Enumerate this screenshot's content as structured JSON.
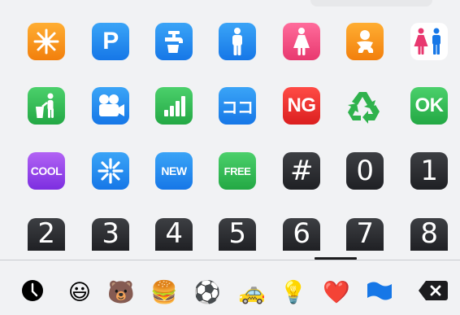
{
  "keyboard": {
    "rows": [
      [
        {
          "id": "eight-pointed-star",
          "icon": "eight-pointed-star-icon",
          "style": "orange"
        },
        {
          "id": "parking",
          "icon": "letter-p",
          "text": "P",
          "style": "blue"
        },
        {
          "id": "potable-water",
          "icon": "potable-water-icon",
          "style": "blue"
        },
        {
          "id": "mens-room",
          "icon": "man-icon",
          "style": "blue"
        },
        {
          "id": "womens-room",
          "icon": "woman-icon",
          "style": "pink"
        },
        {
          "id": "baby-symbol",
          "icon": "baby-icon",
          "style": "orange"
        },
        {
          "id": "restroom",
          "icon": "restroom-icon",
          "style": "white"
        }
      ],
      [
        {
          "id": "put-litter",
          "icon": "litter-bin-icon",
          "style": "green"
        },
        {
          "id": "cinema",
          "icon": "movie-camera-icon",
          "style": "blue"
        },
        {
          "id": "signal-bars",
          "icon": "signal-bars-icon",
          "style": "green"
        },
        {
          "id": "katakana-koko",
          "icon": "koko-icon",
          "text": "ココ",
          "style": "blue"
        },
        {
          "id": "ng-button",
          "icon": "ng-icon",
          "text": "NG",
          "style": "red"
        },
        {
          "id": "recycling",
          "icon": "recycling-icon",
          "style": "plain"
        },
        {
          "id": "ok-button",
          "icon": "ok-icon",
          "text": "OK",
          "style": "green"
        }
      ],
      [
        {
          "id": "cool-button",
          "icon": "cool-icon",
          "text": "COOL",
          "style": "purple"
        },
        {
          "id": "sparkle",
          "icon": "sparkle-icon",
          "style": "blue"
        },
        {
          "id": "new-button",
          "icon": "new-icon",
          "text": "NEW",
          "style": "blue"
        },
        {
          "id": "free-button",
          "icon": "free-icon",
          "text": "FREE",
          "style": "green"
        },
        {
          "id": "keycap-hash",
          "icon": "keycap-hash",
          "text": "#",
          "style": "num"
        },
        {
          "id": "keycap-0",
          "icon": "keycap-0",
          "text": "0",
          "style": "num"
        },
        {
          "id": "keycap-1",
          "icon": "keycap-1",
          "text": "1",
          "style": "num"
        }
      ],
      [
        {
          "id": "keycap-2",
          "icon": "keycap-2",
          "text": "2",
          "style": "num short"
        },
        {
          "id": "keycap-3",
          "icon": "keycap-3",
          "text": "3",
          "style": "num short"
        },
        {
          "id": "keycap-4",
          "icon": "keycap-4",
          "text": "4",
          "style": "num short"
        },
        {
          "id": "keycap-5",
          "icon": "keycap-5",
          "text": "5",
          "style": "num short"
        },
        {
          "id": "keycap-6",
          "icon": "keycap-6",
          "text": "6",
          "style": "num short"
        },
        {
          "id": "keycap-7",
          "icon": "keycap-7",
          "text": "7",
          "style": "num short"
        },
        {
          "id": "keycap-8",
          "icon": "keycap-8",
          "text": "8",
          "style": "num short"
        }
      ]
    ],
    "categories": [
      {
        "id": "recent",
        "icon": "clock-icon",
        "glyph": ""
      },
      {
        "id": "smileys",
        "icon": "grinning-face-icon",
        "glyph": "😃"
      },
      {
        "id": "animals",
        "icon": "bear-icon",
        "glyph": "🐻"
      },
      {
        "id": "food",
        "icon": "hamburger-icon",
        "glyph": "🍔"
      },
      {
        "id": "activity",
        "icon": "soccer-ball-icon",
        "glyph": "⚽"
      },
      {
        "id": "travel",
        "icon": "taxi-icon",
        "glyph": "🚕"
      },
      {
        "id": "objects",
        "icon": "light-bulb-icon",
        "glyph": "💡"
      },
      {
        "id": "symbols",
        "icon": "red-heart-icon",
        "glyph": "❤️"
      },
      {
        "id": "flags",
        "icon": "flag-icon",
        "glyph": ""
      },
      {
        "id": "delete",
        "icon": "backspace-icon",
        "glyph": ""
      }
    ],
    "active_category": "symbols"
  }
}
